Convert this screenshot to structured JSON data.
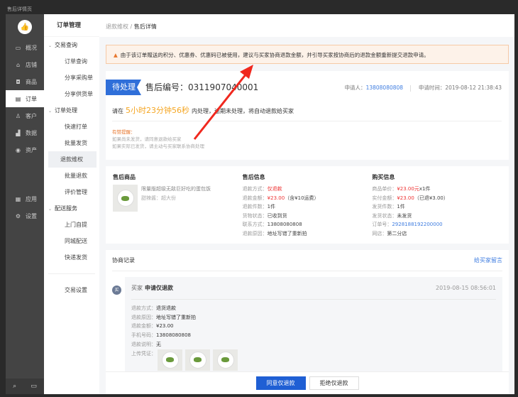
{
  "window_title": "售后详情页",
  "sidebar": {
    "items": [
      {
        "label": "概况",
        "icon": "monitor-icon"
      },
      {
        "label": "店铺",
        "icon": "store-icon"
      },
      {
        "label": "商品",
        "icon": "bag-icon"
      },
      {
        "label": "订单",
        "icon": "order-icon",
        "active": true
      },
      {
        "label": "客户",
        "icon": "user-icon"
      },
      {
        "label": "数据",
        "icon": "chart-icon"
      },
      {
        "label": "资产",
        "icon": "coin-icon"
      }
    ],
    "bottom_items": [
      {
        "label": "应用",
        "icon": "apps-icon"
      },
      {
        "label": "设置",
        "icon": "gear-icon"
      }
    ]
  },
  "nav": {
    "title": "订单管理",
    "groups": [
      {
        "label": "交易查询",
        "items": [
          "订单查询",
          "分享采购单",
          "分享供货单"
        ]
      },
      {
        "label": "订单处理",
        "items": [
          "快速打单",
          "批量发货",
          "退款维权",
          "批量退款",
          "评价管理"
        ]
      },
      {
        "label": "配送服务",
        "items": [
          "上门自提",
          "同城配送",
          "快递发货"
        ]
      }
    ],
    "extra": "交易设置",
    "active": "退款维权"
  },
  "breadcrumb": {
    "parent": "退款维权",
    "sep": "/",
    "current": "售后详情"
  },
  "alert": "由于该订单赠送的积分、优惠券、优惠码已被使用，建议与买家协商退款金额，并引导买家按协商后的退款金额重新提交退款申请。",
  "status": {
    "badge": "待处理",
    "sn_label": "售后编号：",
    "sn": "0311907040001",
    "applicant_label": "申请人：",
    "applicant": "13808080808",
    "time_label": "申请时间：",
    "time": "2019-08-12 21:38:43",
    "count_pre": "请在",
    "countdown": "5小时23分钟56秒",
    "count_post": "内处理，逾期未处理，将自动退款给买家",
    "tips_title": "有赞提醒：",
    "tips": [
      "如果尚未发货，请同意退款给买家",
      "如果实际已发货，请主动与买家联系协商处理"
    ]
  },
  "product": {
    "title": "售后商品",
    "name": "限量版超级无敌巨好吃的蛋包饭",
    "spec": "甜辣酱：超大份"
  },
  "after_sale": {
    "title": "售后信息",
    "rows": [
      {
        "k": "退款方式：",
        "v": "仅退款",
        "red": true
      },
      {
        "k": "退款金额：",
        "v": "¥23.00",
        "extra": "（含¥10运费）",
        "red": true
      },
      {
        "k": "退款件数：",
        "v": "1件"
      },
      {
        "k": "货物状态：",
        "v": "已收到货"
      },
      {
        "k": "联系方式：",
        "v": "13808080808"
      },
      {
        "k": "退款原因：",
        "v": "地址写错了重新拍"
      }
    ]
  },
  "purchase": {
    "title": "购买信息",
    "rows": [
      {
        "k": "商品单价：",
        "v": "¥23.00元",
        "extra": "x1件",
        "red": true
      },
      {
        "k": "实付金额：",
        "v": "¥23.00",
        "extra": "（已退¥3.00）",
        "red": true
      },
      {
        "k": "发货件数：",
        "v": "1件"
      },
      {
        "k": "发货状态：",
        "v": "未发货"
      },
      {
        "k": "订单号：",
        "v": "2928188192200000",
        "blue": true
      },
      {
        "k": "网店：",
        "v": "第二分店"
      }
    ]
  },
  "records": {
    "title": "协商记录",
    "leave_msg": "给买家留言",
    "avatar": "买",
    "role": "买家",
    "action": "申请仅退款",
    "time": "2019-08-15 08:56:01",
    "rows": [
      {
        "k": "退款方式：",
        "v": "退货退款"
      },
      {
        "k": "退款原因：",
        "v": "地址写错了重新拍"
      },
      {
        "k": "退款金额：",
        "v": "¥23.00"
      },
      {
        "k": "手机号码：",
        "v": "13808080808"
      },
      {
        "k": "退款说明：",
        "v": "无"
      }
    ],
    "upload_label": "上传凭证："
  },
  "actions": {
    "agree": "同意仅退款",
    "reject": "拒绝仅退款"
  },
  "colors": {
    "primary": "#1f5fd4",
    "warning": "#f5a623",
    "danger": "#e33333",
    "arrow": "#f0281e"
  }
}
